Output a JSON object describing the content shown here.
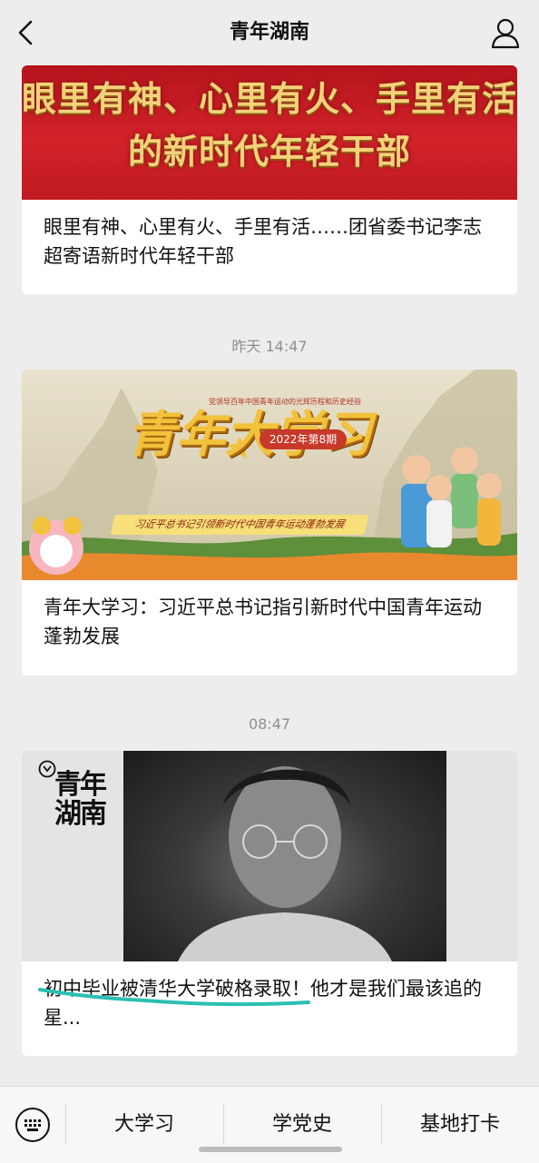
{
  "header": {
    "title": "青年湖南"
  },
  "articles": [
    {
      "banner_lines": [
        "眼里有神、心里有火、手里有活",
        "的新时代年轻干部"
      ],
      "caption": "眼里有神、心里有火、手里有活……团省委书记李志超寄语新时代年轻干部"
    },
    {
      "time": "昨天 14:47",
      "banner_header": "党领导百年中国青年运动的光辉历程和历史经验",
      "banner_title": "青年大学习",
      "banner_badge": "2022年第8期",
      "banner_subtitle": "习近平总书记引领新时代中国青年运动蓬勃发展",
      "caption": "青年大学习：习近平总书记指引新时代中国青年运动蓬勃发展"
    },
    {
      "time": "08:47",
      "banner_logo": "青年湖南",
      "caption": "初中毕业被清华大学破格录取！他才是我们最该追的星..."
    }
  ],
  "bottom_menu": {
    "items": [
      "大学习",
      "学党史",
      "基地打卡"
    ]
  },
  "colors": {
    "background": "#ededed",
    "card": "#ffffff",
    "timestamp": "#8f8f8f",
    "highlight_mark": "#2bbfb0"
  }
}
